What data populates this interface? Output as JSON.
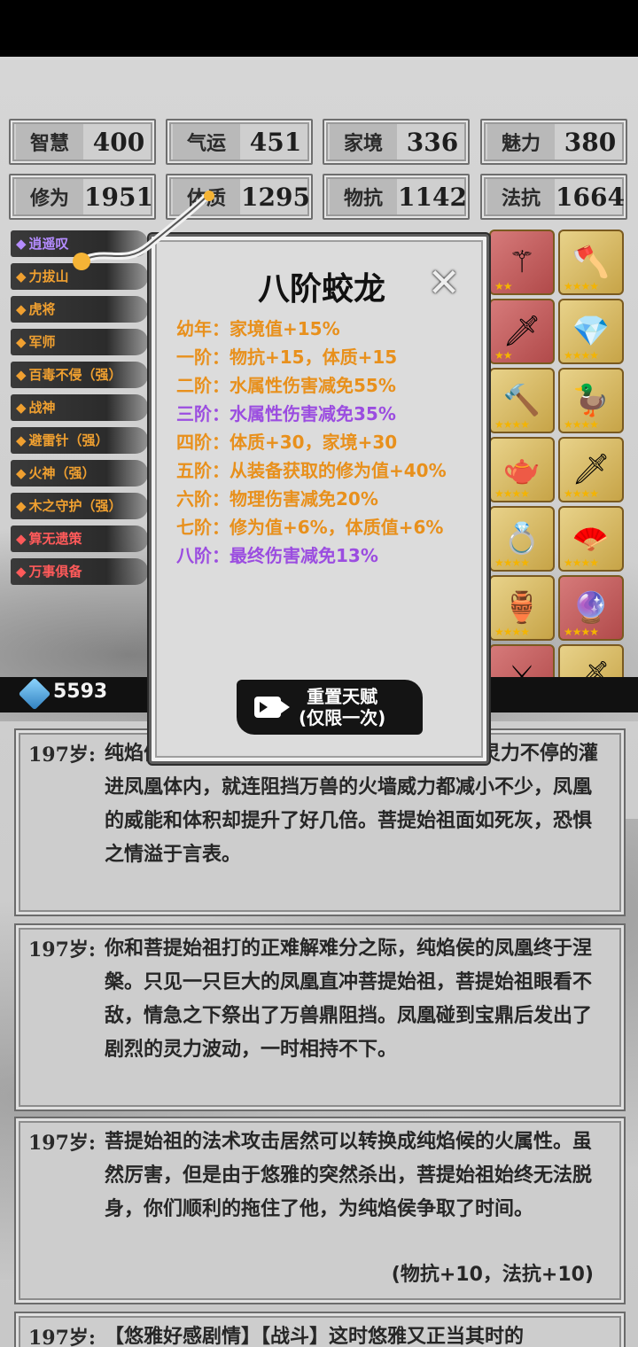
{
  "stats": [
    {
      "label": "智慧",
      "value": "400"
    },
    {
      "label": "气运",
      "value": "451"
    },
    {
      "label": "家境",
      "value": "336"
    },
    {
      "label": "魅力",
      "value": "380"
    },
    {
      "label": "修为",
      "value": "1951"
    },
    {
      "label": "体质",
      "value": "1295"
    },
    {
      "label": "物抗",
      "value": "1142"
    },
    {
      "label": "法抗",
      "value": "1664"
    }
  ],
  "talents": [
    {
      "label": "逍遥叹",
      "color": "#b48cff"
    },
    {
      "label": "力拔山",
      "color": "#f0a030"
    },
    {
      "label": "虎将",
      "color": "#f0a030"
    },
    {
      "label": "军师",
      "color": "#f0a030"
    },
    {
      "label": "百毒不侵（强）",
      "color": "#f0a030"
    },
    {
      "label": "战神",
      "color": "#f0a030"
    },
    {
      "label": "避雷针（强）",
      "color": "#f0a030"
    },
    {
      "label": "火神（强）",
      "color": "#f0a030"
    },
    {
      "label": "木之守护（强）",
      "color": "#f0a030"
    },
    {
      "label": "算无遗策",
      "color": "#ff5a5a"
    },
    {
      "label": "万事俱备",
      "color": "#ff5a5a"
    }
  ],
  "items": [
    {
      "icon": "staff-icon",
      "glyph": "⚚",
      "bg": "red",
      "stars": "★★"
    },
    {
      "icon": "axe-icon",
      "glyph": "🪓",
      "bg": "gold",
      "stars": "★★★★"
    },
    {
      "icon": "cleaver-icon",
      "glyph": "🗡",
      "bg": "red",
      "stars": "★★"
    },
    {
      "icon": "crystal-icon",
      "glyph": "💎",
      "bg": "gold",
      "stars": "★★★★"
    },
    {
      "icon": "hammer-icon",
      "glyph": "🔨",
      "bg": "gold",
      "stars": "★★★★"
    },
    {
      "icon": "duck-icon",
      "glyph": "🦆",
      "bg": "gold",
      "stars": "★★★★"
    },
    {
      "icon": "teapot-icon",
      "glyph": "🫖",
      "bg": "gold",
      "stars": "★★★★"
    },
    {
      "icon": "dagger-icon",
      "glyph": "🗡",
      "bg": "gold",
      "stars": "★★★★"
    },
    {
      "icon": "ring-icon",
      "glyph": "💍",
      "bg": "gold",
      "stars": "★★★★"
    },
    {
      "icon": "fan-icon",
      "glyph": "🪭",
      "bg": "gold",
      "stars": "★★★★"
    },
    {
      "icon": "cauldron-icon",
      "glyph": "🏺",
      "bg": "gold",
      "stars": "★★★★"
    },
    {
      "icon": "mirror-icon",
      "glyph": "🔮",
      "bg": "red",
      "stars": "★★★★"
    },
    {
      "icon": "sword-icon",
      "glyph": "⚔",
      "bg": "red",
      "stars": "★★★"
    },
    {
      "icon": "blade-icon",
      "glyph": "🗡",
      "bg": "gold",
      "stars": "★★★★"
    }
  ],
  "currency": {
    "value": "5593"
  },
  "modal": {
    "title": "八阶蛟龙",
    "close_glyph": "✕",
    "tiers": [
      {
        "text": "幼年：家境值+15%",
        "color": "#e8901c"
      },
      {
        "text": "一阶：物抗+15，体质+15",
        "color": "#e8901c"
      },
      {
        "text": "二阶：水属性伤害减免55%",
        "color": "#e8901c"
      },
      {
        "text": "三阶：水属性伤害减免35%",
        "color": "#9b4de0"
      },
      {
        "text": "四阶：体质+30，家境+30",
        "color": "#e8901c"
      },
      {
        "text": "五阶：从装备获取的修为值+40%",
        "color": "#e8901c"
      },
      {
        "text": "六阶：物理伤害减免20%",
        "color": "#e8901c"
      },
      {
        "text": "七阶：修为值+6%，体质值+6%",
        "color": "#e8901c"
      },
      {
        "text": "八阶：最终伤害减免13%",
        "color": "#9b4de0"
      }
    ],
    "reset_line1": "重置天赋",
    "reset_line2": "(仅限一次)"
  },
  "log": [
    {
      "age": "197岁:",
      "text": "纯焰侯大喊一声“凤凰涅槃”。他青筋暴起，灵力不停的灌进凤凰体内，就连阻挡万兽的火墙威力都减小不少，凤凰的威能和体积却提升了好几倍。菩提始祖面如死灰，恐惧之情溢于言表。",
      "bonus": ""
    },
    {
      "age": "197岁:",
      "text": "你和菩提始祖打的正难解难分之际，纯焰侯的凤凰终于涅槃。只见一只巨大的凤凰直冲菩提始祖，菩提始祖眼看不敌，情急之下祭出了万兽鼎阻挡。凤凰碰到宝鼎后发出了剧烈的灵力波动，一时相持不下。",
      "bonus": ""
    },
    {
      "age": "197岁:",
      "text": "菩提始祖的法术攻击居然可以转换成纯焰候的火属性。虽然厉害，但是由于悠雅的突然杀出，菩提始祖始终无法脱身，你们顺利的拖住了他，为纯焰侯争取了时间。",
      "bonus": "(物抗+10，法抗+10)"
    },
    {
      "age": "197岁:",
      "text": "【悠雅好感剧情】【战斗】这时悠雅又正当其时的",
      "bonus": ""
    }
  ]
}
